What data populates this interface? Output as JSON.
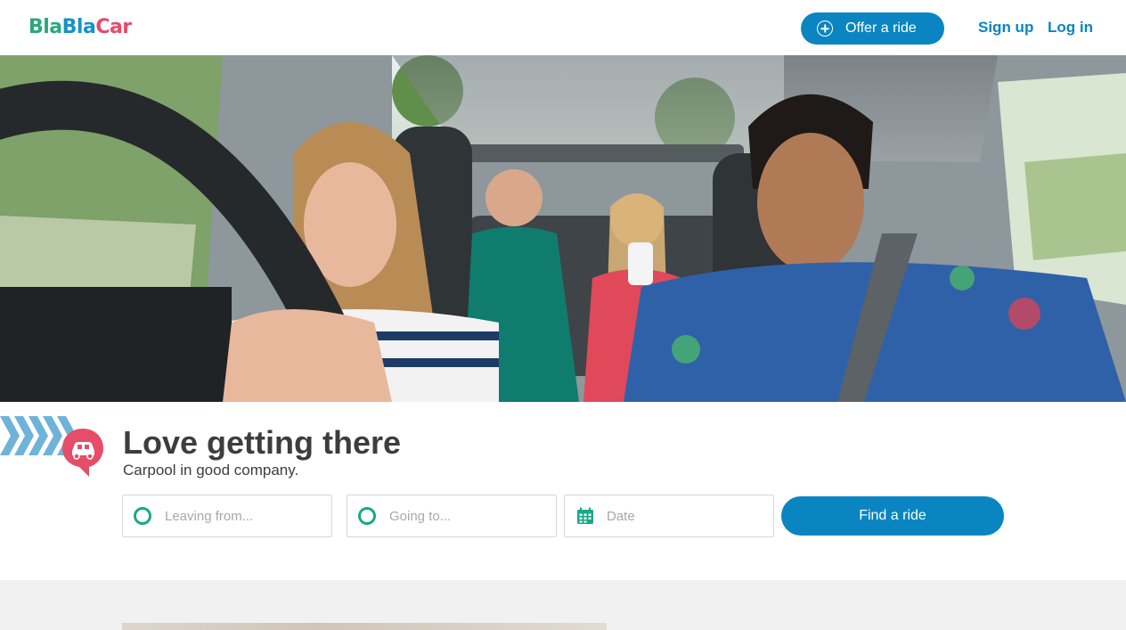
{
  "header": {
    "logo": {
      "part1": "Bla",
      "part2": "Bla",
      "part3": "Car"
    },
    "offer_ride": "Offer a ride",
    "sign_up": "Sign up",
    "log_in": "Log in"
  },
  "hero": {
    "tagline": "Love getting there",
    "subtitle": "Carpool in good company."
  },
  "search": {
    "leaving_placeholder": "Leaving from...",
    "going_placeholder": "Going to...",
    "date_placeholder": "Date",
    "find_button": "Find a ride"
  },
  "icons": {
    "offer": "plus-circle-icon",
    "origin": "origin-ring-icon",
    "destination": "destination-ring-icon",
    "date": "calendar-icon",
    "brand": "car-speech-bubble-icon",
    "decor": "chevron-stripes"
  },
  "colors": {
    "primary": "#0a85c2",
    "accent_green": "#1ba887",
    "accent_red": "#e54d68",
    "chevron_blue": "#6fb3d9"
  }
}
